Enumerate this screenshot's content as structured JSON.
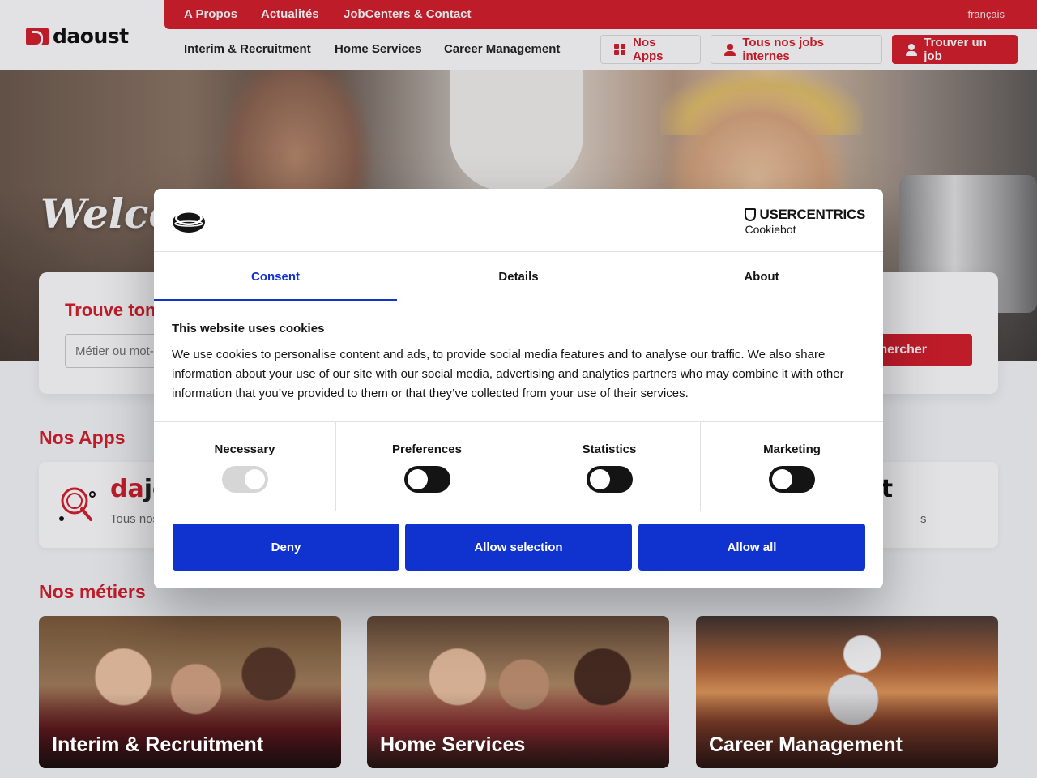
{
  "header": {
    "logo_text": "daoust",
    "top_links": [
      "A Propos",
      "Actualités",
      "JobCenters & Contact"
    ],
    "language": "français",
    "main_nav": [
      "Interim & Recruitment",
      "Home Services",
      "Career Management"
    ],
    "btn_apps": "Nos Apps",
    "btn_internal_jobs": "Tous nos jobs internes",
    "btn_find_job": "Trouver un job",
    "brand_color": "#d71e2b"
  },
  "hero": {
    "welcome": "Welcome"
  },
  "search": {
    "title": "Trouve ton job",
    "placeholder": "Métier ou mot-clé",
    "button": "Rechercher"
  },
  "apps": {
    "title": "Nos Apps",
    "app1_name_red": "da",
    "app1_name_dark": "job",
    "app1_desc": "Tous nos jobs",
    "app2_name": "ct",
    "app2_desc": "s"
  },
  "metiers": {
    "title": "Nos métiers",
    "items": [
      "Interim & Recruitment",
      "Home Services",
      "Career Management"
    ]
  },
  "cookie_dialog": {
    "brand_top": "USERCENTRICS",
    "brand_bottom": "Cookiebot",
    "tabs": [
      "Consent",
      "Details",
      "About"
    ],
    "active_tab": "Consent",
    "heading": "This website uses cookies",
    "body": "We use cookies to personalise content and ads, to provide social media features and to analyse our traffic. We also share information about your use of our site with our social media, advertising and analytics partners who may combine it with other information that you’ve provided to them or that they’ve collected from your use of their services.",
    "categories": [
      {
        "label": "Necessary",
        "state": "on-disabled"
      },
      {
        "label": "Preferences",
        "state": "off"
      },
      {
        "label": "Statistics",
        "state": "off"
      },
      {
        "label": "Marketing",
        "state": "off"
      }
    ],
    "buttons": [
      "Deny",
      "Allow selection",
      "Allow all"
    ],
    "accent_color": "#1032cf"
  }
}
